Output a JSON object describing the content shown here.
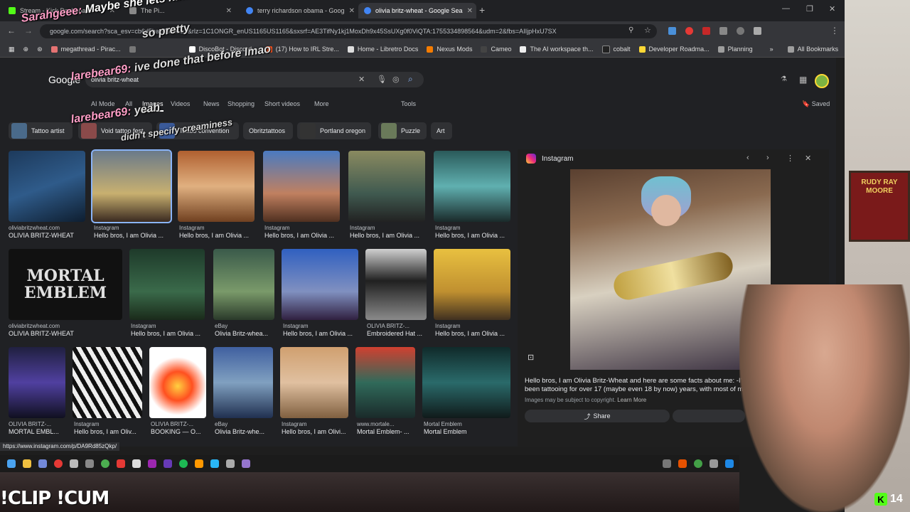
{
  "tabs": [
    {
      "label": "Stream - Kick Dashboard",
      "color": "#53fc18"
    },
    {
      "label": "The Pi...",
      "color": "#888"
    },
    {
      "label": "terry richardson obama - Goog",
      "color": "#4285f4"
    },
    {
      "label": "olivia britz-wheat - Google Sea",
      "color": "#4285f4"
    }
  ],
  "url": "google.com/search?sca_esv=cb6d5bae78091a1&rlz=1C1ONGR_enUS1165US1165&sxsrf=AE3TifNy1kj1MoxDh9x45SsUXg0f0ViQTA:1755334898564&udm=2&fbs=AIIjpHxU7SX",
  "bookmarks": [
    "megathread - Pirac...",
    "",
    "DiscoBot - Discord...",
    "(17) How to IRL Stre...",
    "Home - Libretro Docs",
    "Nexus Mods",
    "Cameo",
    "The AI workspace th...",
    "cobalt",
    "Developer Roadma...",
    "Planning",
    "All Bookmarks"
  ],
  "search": {
    "logo": "Google",
    "query": "olivia britz-wheat"
  },
  "nav": [
    "AI Mode",
    "All",
    "Images",
    "Videos",
    "News",
    "Shopping",
    "Short videos",
    "More",
    "Tools"
  ],
  "saved": "Saved",
  "chips": [
    "Tattoo artist",
    "Void tattoo fest",
    "Tattoo convention",
    "Obritztattoos",
    "Portland oregon",
    "Puzzle",
    "Art"
  ],
  "results": [
    {
      "src": "oliviabritzwheat.com",
      "title": "OLIVIA BRITZ-WHEAT"
    },
    {
      "src": "Instagram",
      "title": "Hello bros, I am Olivia ..."
    },
    {
      "src": "Instagram",
      "title": "Hello bros, I am Olivia ..."
    },
    {
      "src": "Instagram",
      "title": "Hello bros, I am Olivia ..."
    },
    {
      "src": "Instagram",
      "title": "Hello bros, I am Olivia ..."
    },
    {
      "src": "Instagram",
      "title": "Hello bros, I am Olivia ..."
    },
    {
      "src": "oliviabritzwheat.com",
      "title": "OLIVIA BRITZ-WHEAT"
    },
    {
      "src": "Instagram",
      "title": "Hello bros, I am Olivia ..."
    },
    {
      "src": "eBay",
      "title": "Olivia Britz-whea..."
    },
    {
      "src": "Instagram",
      "title": "Hello bros, I am Olivia ..."
    },
    {
      "src": "OLIVIA BRITZ-...",
      "title": "Embroidered Hat ..."
    },
    {
      "src": "Instagram",
      "title": "Hello bros, I am Olivia ..."
    },
    {
      "src": "OLIVIA BRITZ-...",
      "title": "MORTAL EMBL..."
    },
    {
      "src": "Instagram",
      "title": "Hello bros, I am Oliv..."
    },
    {
      "src": "OLIVIA BRITZ-...",
      "title": "BOOKING — O..."
    },
    {
      "src": "eBay",
      "title": "Olivia Britz-whe..."
    },
    {
      "src": "Instagram",
      "title": "Hello bros, I am Olivi..."
    },
    {
      "src": "www.mortale...",
      "title": "Mortal Emblem- ..."
    },
    {
      "src": "Mortal Emblem",
      "title": "Mortal Emblem"
    }
  ],
  "mortal_emblem_text": "MORTAL EMBLEM",
  "preview": {
    "source": "Instagram",
    "caption": "Hello bros, I am Olivia Britz-Wheat and here are some facts about me: -I've been tattooing for over 17 (maybe even 18 by now) years, with most of m",
    "notice": "Images may be subject to copyright.",
    "learn_more": "Learn More",
    "share": "Share"
  },
  "status_url": "https://www.instagram.com/p/DA9Rd85zQkp/",
  "chat": [
    {
      "user": "Sarahgeee:",
      "msg": "Maybe she lets him"
    },
    {
      "user": "",
      "msg": "so pretty"
    },
    {
      "user": "larebear69:",
      "msg": "ive done that before lmao"
    },
    {
      "user": "larebear69:",
      "msg": "yeah"
    },
    {
      "user": "",
      "msg": "didn't specify creaminess"
    }
  ],
  "overlay": {
    "commands": "!CLIP !CUM",
    "viewers": "14"
  },
  "poster_text": "RUDY RAY MOORE"
}
